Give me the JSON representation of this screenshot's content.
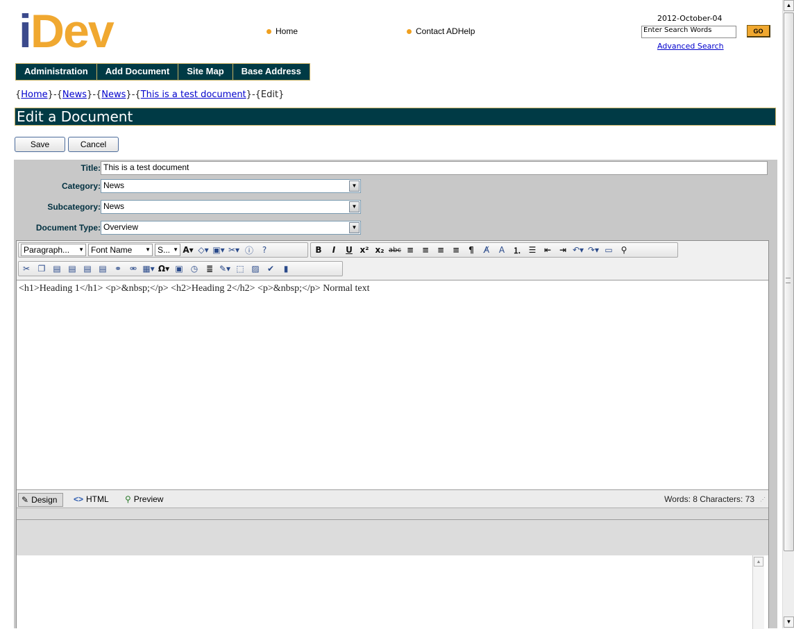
{
  "header": {
    "logo_i": "i",
    "logo_dev": "Dev",
    "links": [
      "Home",
      "Contact ADHelp"
    ],
    "date": "2012-October-04",
    "search_value": "Enter Search Words",
    "go_label": "GO",
    "advanced_search": "Advanced Search"
  },
  "nav": [
    "Administration",
    "Add Document",
    "Site Map",
    "Base Address"
  ],
  "breadcrumb": {
    "home": "Home",
    "news1": "News",
    "news2": "News",
    "doc": "This is a test document",
    "edit": "Edit"
  },
  "page_title": "Edit a Document",
  "buttons": {
    "save": "Save",
    "cancel": "Cancel"
  },
  "form": {
    "title_label": "Title:",
    "title_value": "This is a test document",
    "category_label": "Category:",
    "category_value": "News",
    "subcategory_label": "Subcategory:",
    "subcategory_value": "News",
    "doctype_label": "Document Type:",
    "doctype_value": "Overview"
  },
  "editor": {
    "paragraph": "Paragraph...",
    "font_name": "Font Name",
    "size": "S...",
    "content": "<h1>Heading 1</h1> <p>&nbsp;</p> <h2>Heading 2</h2> <p>&nbsp;</p> Normal text",
    "modes": {
      "design": "Design",
      "html": "HTML",
      "preview": "Preview"
    },
    "stats": "Words: 8  Characters: 73"
  },
  "colors": {
    "brand_blue": "#3b4a8c",
    "brand_orange": "#f0a830",
    "nav_bg": "#003a45"
  }
}
